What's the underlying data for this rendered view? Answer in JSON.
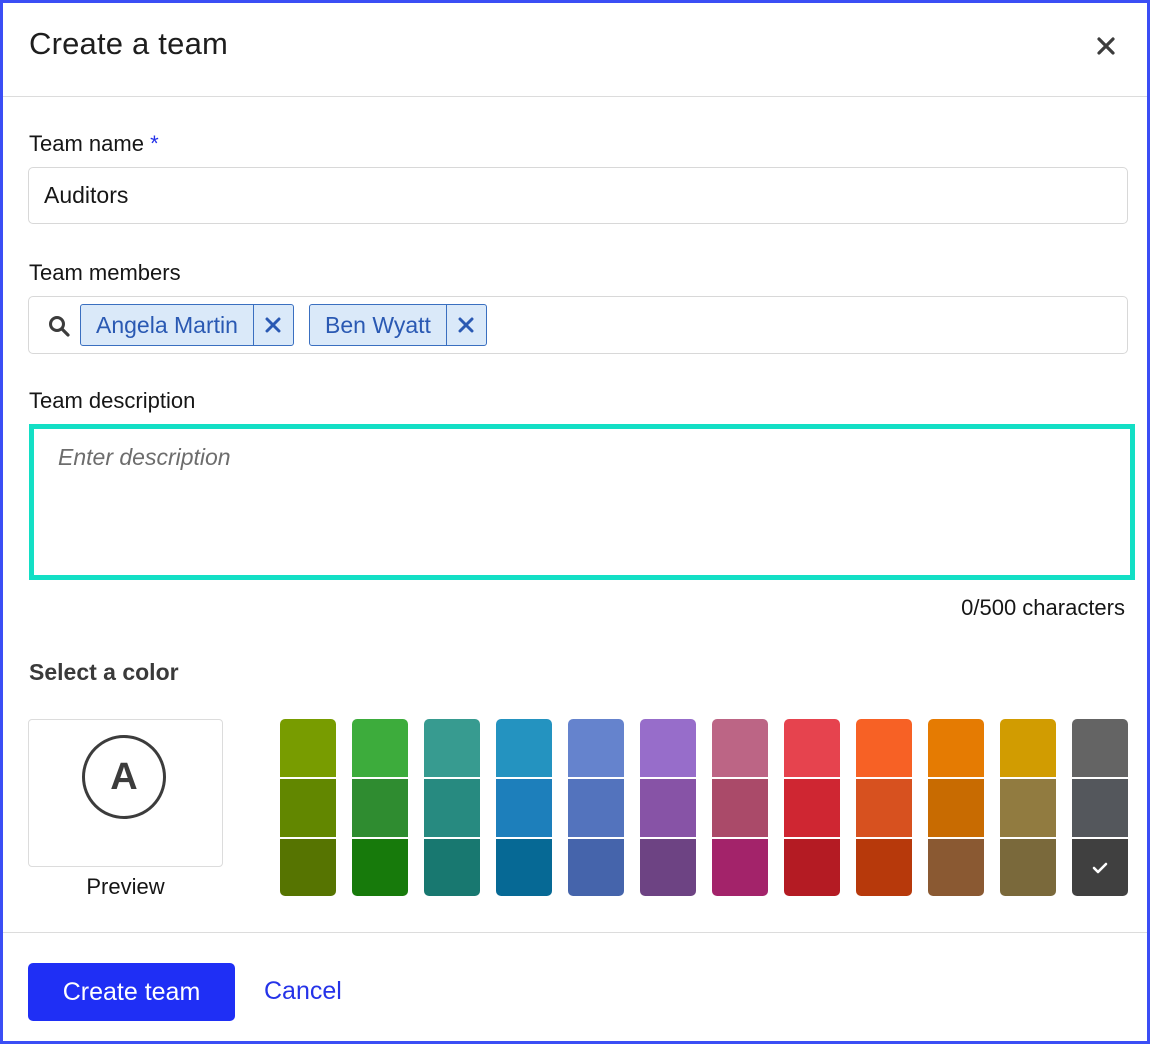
{
  "dialog": {
    "title": "Create a team"
  },
  "team_name": {
    "label": "Team name",
    "required_marker": "*",
    "value": "Auditors"
  },
  "team_members": {
    "label": "Team members",
    "tags": [
      {
        "name": "Angela Martin"
      },
      {
        "name": "Ben Wyatt"
      }
    ]
  },
  "team_description": {
    "label": "Team description",
    "placeholder": "Enter description",
    "counter": "0/500 characters"
  },
  "color_picker": {
    "heading": "Select a color",
    "preview_initial": "A",
    "preview_label": "Preview",
    "palette": [
      [
        "#789c00",
        "#628700",
        "#567401"
      ],
      [
        "#3dac3c",
        "#2f8c30",
        "#177a0b"
      ],
      [
        "#379b90",
        "#278a80",
        "#187870"
      ],
      [
        "#2493c0",
        "#1d7fbb",
        "#066995"
      ],
      [
        "#6583cd",
        "#5373bd",
        "#4564ab"
      ],
      [
        "#976dca",
        "#8753a6",
        "#6d4383"
      ],
      [
        "#bc6585",
        "#aa4a69",
        "#a3236a"
      ],
      [
        "#e6434e",
        "#cf2632",
        "#b41b23"
      ],
      [
        "#f76125",
        "#d7511f",
        "#b7390b"
      ],
      [
        "#e57b02",
        "#c86b01",
        "#8a5932"
      ],
      [
        "#d19c01",
        "#917b40",
        "#7a693b"
      ],
      [
        "#646464",
        "#54575c",
        "#404040"
      ]
    ],
    "selected": {
      "column": 11,
      "row": 2
    },
    "check_icon": "check-icon"
  },
  "footer": {
    "primary_label": "Create team",
    "secondary_label": "Cancel"
  },
  "colors": {
    "accent": "#1f2ff5",
    "focus_ring": "#13dfc5",
    "tag_bg": "#dae9f9",
    "tag_text": "#2a59b3"
  }
}
